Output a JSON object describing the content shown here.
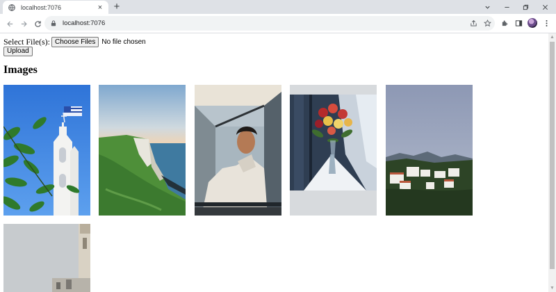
{
  "browser": {
    "tab_title": "localhost:7076",
    "tab_close": "×",
    "new_tab": "+",
    "url": "localhost:7076"
  },
  "form": {
    "select_label": "Select File(s):",
    "choose_button": "Choose Files",
    "no_file_text": "No file chosen",
    "upload_button": "Upload"
  },
  "gallery": {
    "heading": "Images",
    "images": [
      {
        "subject": "white church bell tower, blue sky, green leaves"
      },
      {
        "subject": "green cliffs by the sea at dusk"
      },
      {
        "subject": "young man in white hoodie by window"
      },
      {
        "subject": "flowers in glass vase by window"
      },
      {
        "subject": "white hillside village under cloudy sky"
      },
      {
        "subject": "building tower against pale sky"
      }
    ]
  }
}
